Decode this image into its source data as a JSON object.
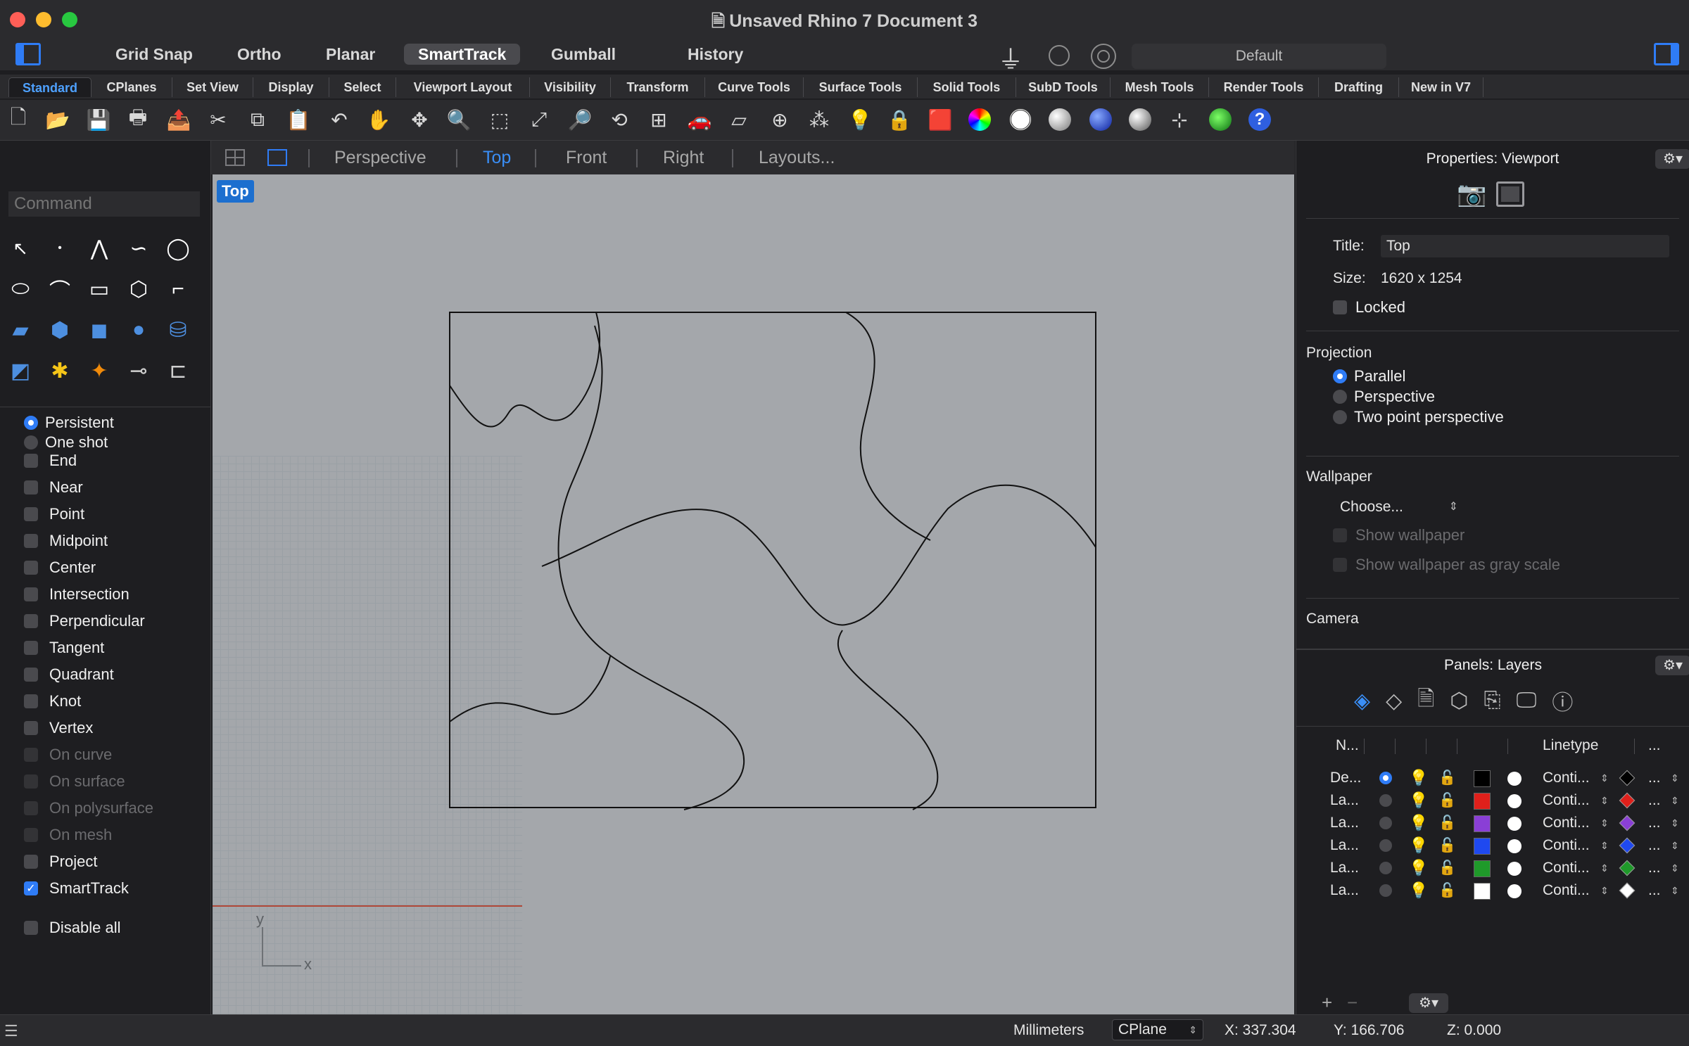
{
  "window": {
    "title": "Unsaved Rhino 7 Document 3"
  },
  "modes": [
    "Grid Snap",
    "Ortho",
    "Planar",
    "SmartTrack",
    "Gumball",
    "History"
  ],
  "active_mode": "SmartTrack",
  "display_mode": "Default",
  "tabs": [
    "Standard",
    "CPlanes",
    "Set View",
    "Display",
    "Select",
    "Viewport Layout",
    "Visibility",
    "Transform",
    "Curve Tools",
    "Surface Tools",
    "Solid Tools",
    "SubD Tools",
    "Mesh Tools",
    "Render Tools",
    "Drafting",
    "New in V7"
  ],
  "active_tab": "Standard",
  "command": {
    "placeholder": "Command"
  },
  "osnap": {
    "mode_persistent": "Persistent",
    "mode_oneshot": "One shot",
    "items": [
      {
        "label": "End",
        "checked": false,
        "enabled": true
      },
      {
        "label": "Near",
        "checked": false,
        "enabled": true
      },
      {
        "label": "Point",
        "checked": false,
        "enabled": true
      },
      {
        "label": "Midpoint",
        "checked": false,
        "enabled": true
      },
      {
        "label": "Center",
        "checked": false,
        "enabled": true
      },
      {
        "label": "Intersection",
        "checked": false,
        "enabled": true
      },
      {
        "label": "Perpendicular",
        "checked": false,
        "enabled": true
      },
      {
        "label": "Tangent",
        "checked": false,
        "enabled": true
      },
      {
        "label": "Quadrant",
        "checked": false,
        "enabled": true
      },
      {
        "label": "Knot",
        "checked": false,
        "enabled": true
      },
      {
        "label": "Vertex",
        "checked": false,
        "enabled": true
      },
      {
        "label": "On curve",
        "checked": false,
        "enabled": false
      },
      {
        "label": "On surface",
        "checked": false,
        "enabled": false
      },
      {
        "label": "On polysurface",
        "checked": false,
        "enabled": false
      },
      {
        "label": "On mesh",
        "checked": false,
        "enabled": false
      },
      {
        "label": "Project",
        "checked": false,
        "enabled": true
      },
      {
        "label": "SmartTrack",
        "checked": true,
        "enabled": true
      }
    ],
    "disable_all": "Disable all"
  },
  "viewport_tabs": [
    "Perspective",
    "Top",
    "Front",
    "Right",
    "Layouts..."
  ],
  "active_viewport_tab": "Top",
  "viewport": {
    "label": "Top",
    "axis_x": "x",
    "axis_y": "y"
  },
  "properties": {
    "panel_title": "Properties: Viewport",
    "title_label": "Title:",
    "title_value": "Top",
    "size_label": "Size:",
    "size_value": "1620 x 1254",
    "locked_label": "Locked",
    "projection_heading": "Projection",
    "projection_options": [
      "Parallel",
      "Perspective",
      "Two point perspective"
    ],
    "projection_selected": "Parallel",
    "wallpaper_heading": "Wallpaper",
    "wallpaper_choose": "Choose...",
    "show_wallpaper": "Show wallpaper",
    "show_wallpaper_gray": "Show wallpaper as gray scale",
    "camera_heading": "Camera"
  },
  "layers": {
    "panel_title": "Panels: Layers",
    "columns": {
      "name": "N...",
      "linetype": "Linetype",
      "more": "..."
    },
    "rows": [
      {
        "name": "De...",
        "current": true,
        "color": "#000000",
        "linetype": "Conti...",
        "print_color": "#000000",
        "more": "..."
      },
      {
        "name": "La...",
        "current": false,
        "color": "#e0201b",
        "linetype": "Conti...",
        "print_color": "#e0201b",
        "more": "..."
      },
      {
        "name": "La...",
        "current": false,
        "color": "#8a3fd6",
        "linetype": "Conti...",
        "print_color": "#8a3fd6",
        "more": "..."
      },
      {
        "name": "La...",
        "current": false,
        "color": "#1f49f0",
        "linetype": "Conti...",
        "print_color": "#1f49f0",
        "more": "..."
      },
      {
        "name": "La...",
        "current": false,
        "color": "#1f9a2a",
        "linetype": "Conti...",
        "print_color": "#1f9a2a",
        "more": "..."
      },
      {
        "name": "La...",
        "current": false,
        "color": "#ffffff",
        "linetype": "Conti...",
        "print_color": "#ffffff",
        "more": "..."
      }
    ],
    "add": "+",
    "remove": "−"
  },
  "status": {
    "units": "Millimeters",
    "cplane": "CPlane",
    "x": "X: 337.304",
    "y": "Y: 166.706",
    "z": "Z: 0.000"
  }
}
